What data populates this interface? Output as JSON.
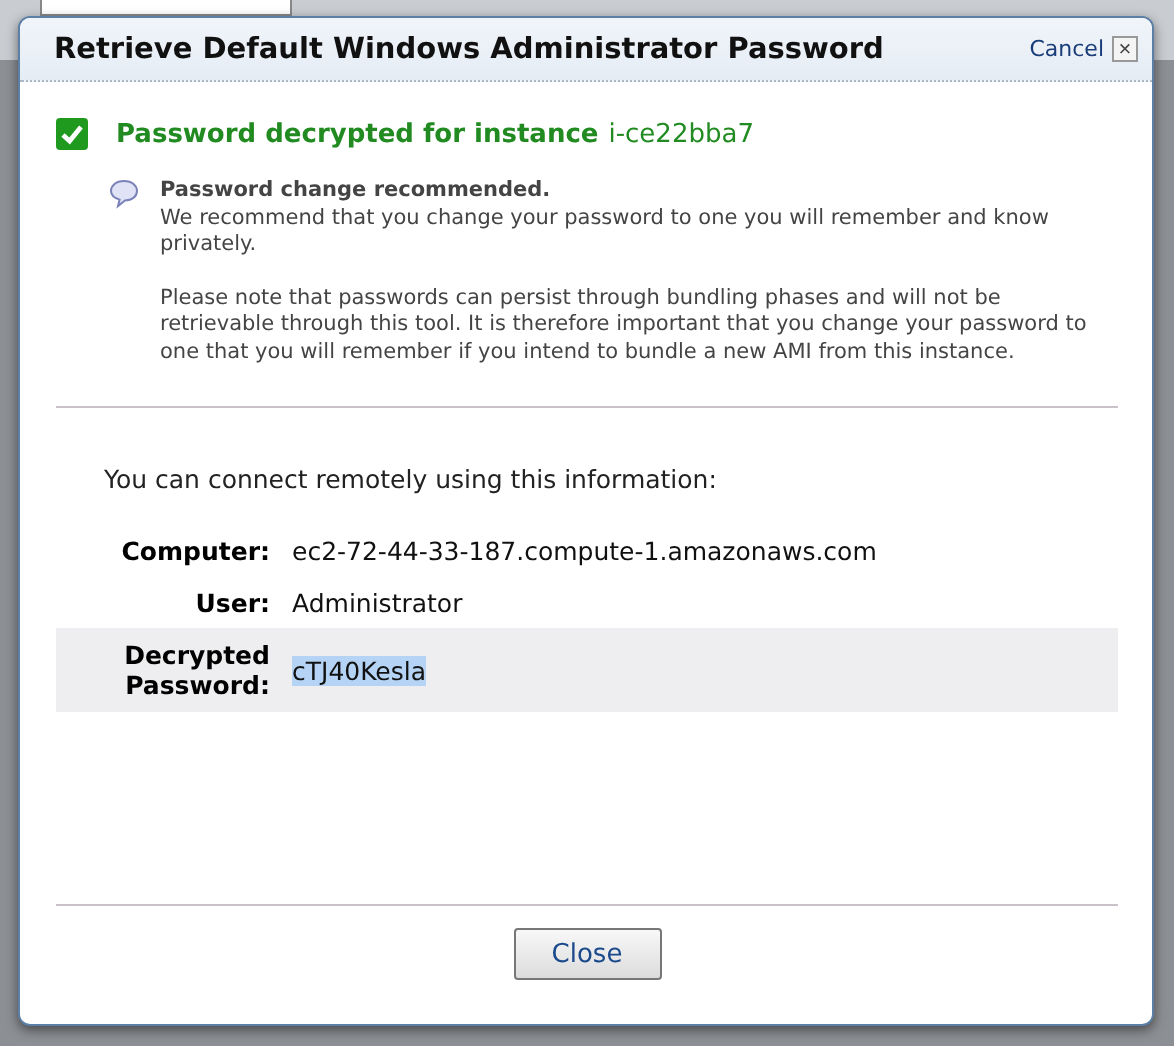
{
  "dialog": {
    "title": "Retrieve Default Windows Administrator Password",
    "cancel_link": "Cancel",
    "close_icon": "×",
    "status": {
      "message": "Password decrypted for instance",
      "instance_id": "i-ce22bba7"
    },
    "notice": {
      "heading": "Password change recommended.",
      "paragraphs": [
        "We recommend that you change your password to one you will remember and know privately.",
        "Please note that passwords can persist through bundling phases and will not be retrievable through this tool. It is therefore important that you change your password to one that you will remember if you intend to bundle a new AMI from this instance."
      ]
    },
    "intro": "You can connect remotely using this information:",
    "fields": [
      {
        "label": "Computer:",
        "value": "ec2-72-44-33-187.compute-1.amazonaws.com",
        "highlighted": false,
        "selected": false
      },
      {
        "label": "User:",
        "value": "Administrator",
        "highlighted": false,
        "selected": false
      },
      {
        "label": "Decrypted Password:",
        "value": "cTJ40Kesla",
        "highlighted": true,
        "selected": true
      }
    ],
    "buttons": [
      "Close"
    ]
  }
}
